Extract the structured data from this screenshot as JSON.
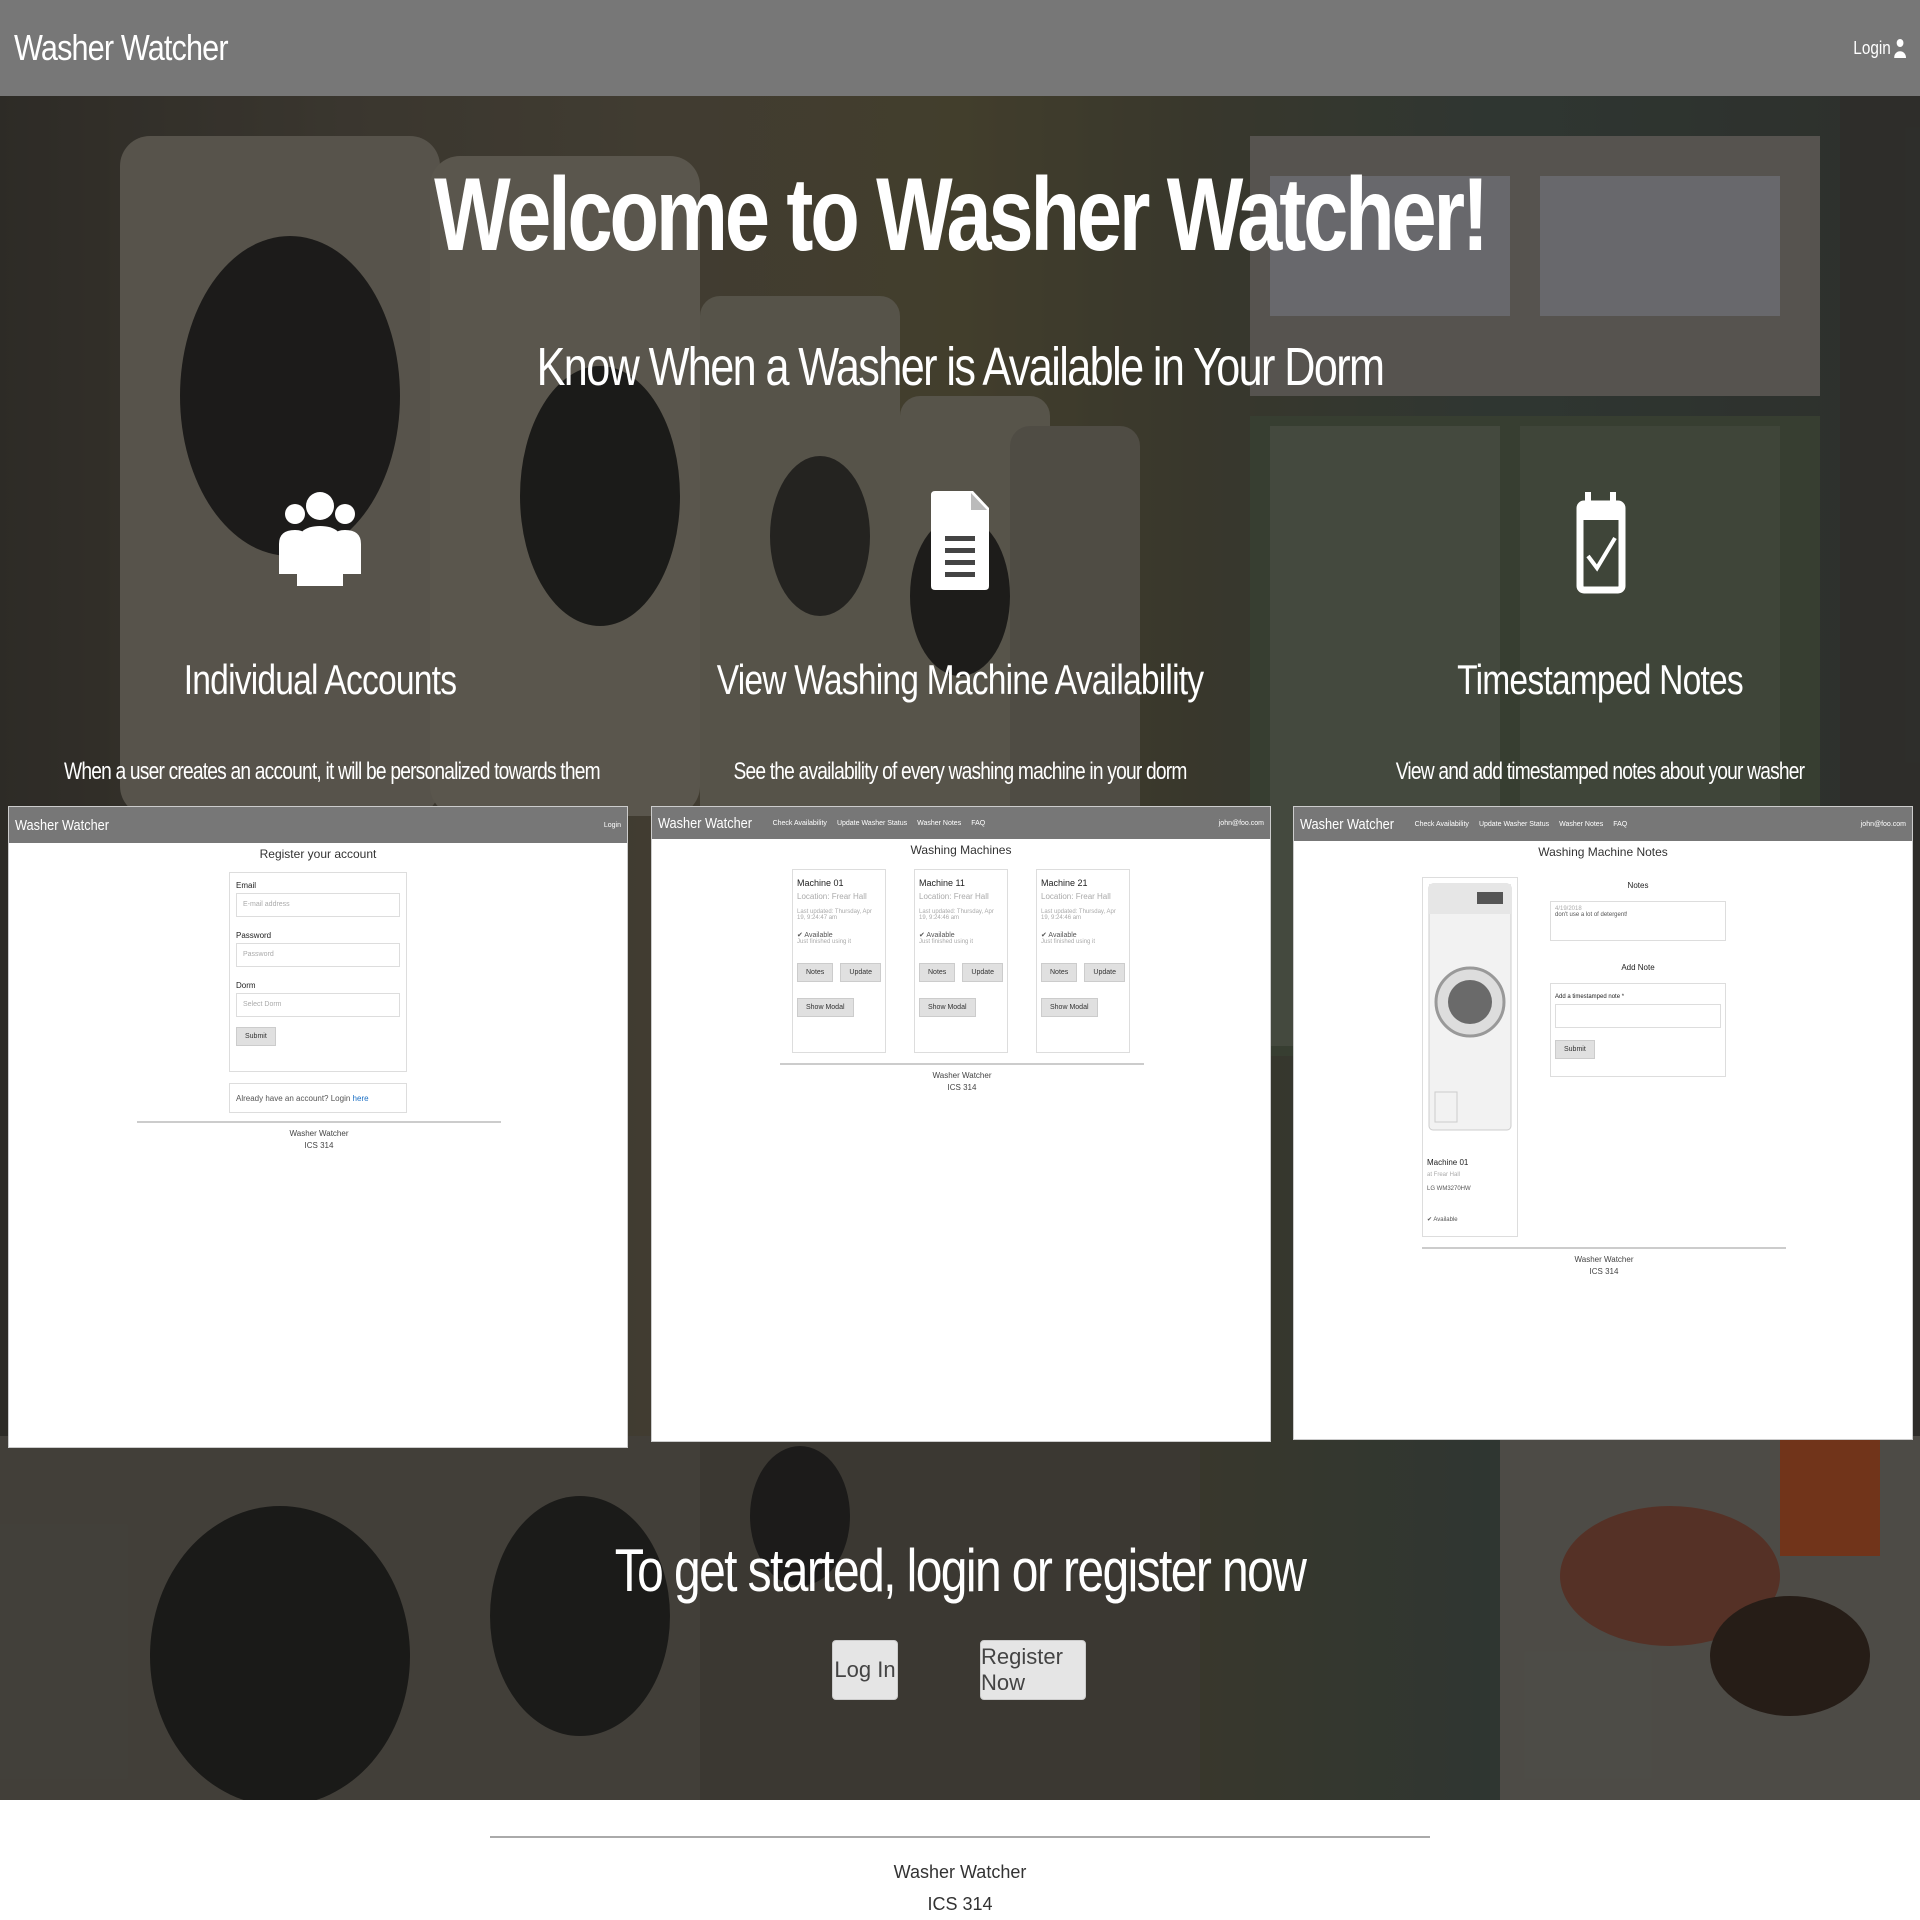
{
  "navbar": {
    "brand": "Washer Watcher",
    "login": "Login"
  },
  "hero": {
    "title": "Welcome to Washer Watcher!",
    "subtitle": "Know When a Washer is Available in Your Dorm",
    "features": [
      {
        "icon": "users-icon",
        "title": "Individual Accounts",
        "description": "When a user creates an account, it will be personalized towards them"
      },
      {
        "icon": "file-text-icon",
        "title": "View Washing Machine Availability",
        "description": "See the availability of every washing machine in your dorm"
      },
      {
        "icon": "calendar-check-icon",
        "title": "Timestamped Notes",
        "description": "View and add timestamped notes about your washer"
      }
    ],
    "cta": "To get started, login or register now",
    "login_button": "Log In",
    "register_button": "Register Now"
  },
  "screenshots": {
    "register": {
      "brand": "Washer Watcher",
      "login": "Login",
      "title": "Register your account",
      "email_label": "Email",
      "email_placeholder": "E-mail address",
      "password_label": "Password",
      "password_placeholder": "Password",
      "dorm_label": "Dorm",
      "dorm_placeholder": "Select Dorm",
      "submit": "Submit",
      "already": "Already have an account? Login",
      "already_link": "here",
      "footer1": "Washer Watcher",
      "footer2": "ICS 314"
    },
    "machines": {
      "brand": "Washer Watcher",
      "nav": [
        "Check Availability",
        "Update Washer Status",
        "Washer Notes",
        "FAQ"
      ],
      "user": "john@foo.com",
      "title": "Washing Machines",
      "cards": [
        {
          "name": "Machine 01",
          "location": "Location: Frear Hall",
          "updated": "Last updated: Thursday, Apr 19, 9:24:47 am",
          "status": "✔ Available",
          "sub": "Just finished using it",
          "notes": "Notes",
          "update": "Update",
          "modal": "Show Modal"
        },
        {
          "name": "Machine 11",
          "location": "Location: Frear Hall",
          "updated": "Last updated: Thursday, Apr 19, 9:24:46 am",
          "status": "✔ Available",
          "sub": "Just finished using it",
          "notes": "Notes",
          "update": "Update",
          "modal": "Show Modal"
        },
        {
          "name": "Machine 21",
          "location": "Location: Frear Hall",
          "updated": "Last updated: Thursday, Apr 19, 9:24:46 am",
          "status": "✔ Available",
          "sub": "Just finished using it",
          "notes": "Notes",
          "update": "Update",
          "modal": "Show Modal"
        }
      ],
      "footer1": "Washer Watcher",
      "footer2": "ICS 314"
    },
    "notes": {
      "brand": "Washer Watcher",
      "nav": [
        "Check Availability",
        "Update Washer Status",
        "Washer Notes",
        "FAQ"
      ],
      "user": "john@foo.com",
      "title": "Washing Machine Notes",
      "notes_header": "Notes",
      "note_time": "4/19/2018",
      "note_text": "don't use a lot of detergent!",
      "add_note_header": "Add Note",
      "add_label": "Add a timestamped note *",
      "submit": "Submit",
      "machine_name": "Machine 01",
      "machine_loc": "at Frear Hall",
      "machine_id": "LG WM3270HW",
      "machine_status": "✔ Available",
      "footer1": "Washer Watcher",
      "footer2": "ICS 314"
    }
  },
  "footer": {
    "line1": "Washer Watcher",
    "line2": "ICS 314"
  }
}
